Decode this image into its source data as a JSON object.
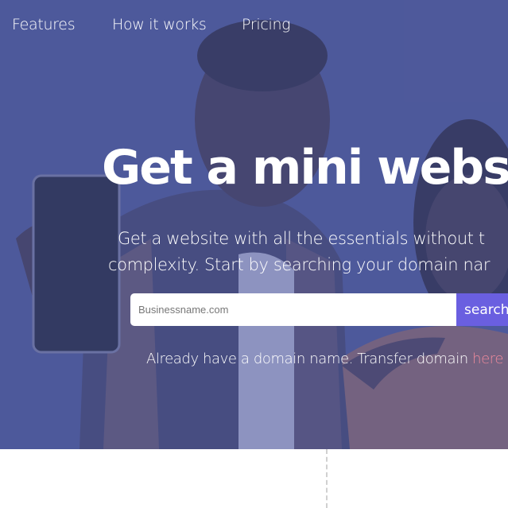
{
  "nav": {
    "items": [
      {
        "label": "Features"
      },
      {
        "label": "How it works"
      },
      {
        "label": "Pricing"
      }
    ]
  },
  "hero": {
    "headline": "Get a mini websit",
    "subtitle_line1": "Get a website with all the essentials without t",
    "subtitle_line2": "complexity. Start by searching your domain nar",
    "search": {
      "placeholder": "Businessname.com",
      "value": "",
      "button_label": "search"
    },
    "transfer_text": "Already have a domain name. Transfer domain",
    "transfer_link": "here"
  },
  "colors": {
    "overlay": "#505ca0",
    "accent_button": "#6a5fe0",
    "link": "#f08a9c"
  },
  "icons": {
    "hero_image": "people-with-phone-photo"
  }
}
